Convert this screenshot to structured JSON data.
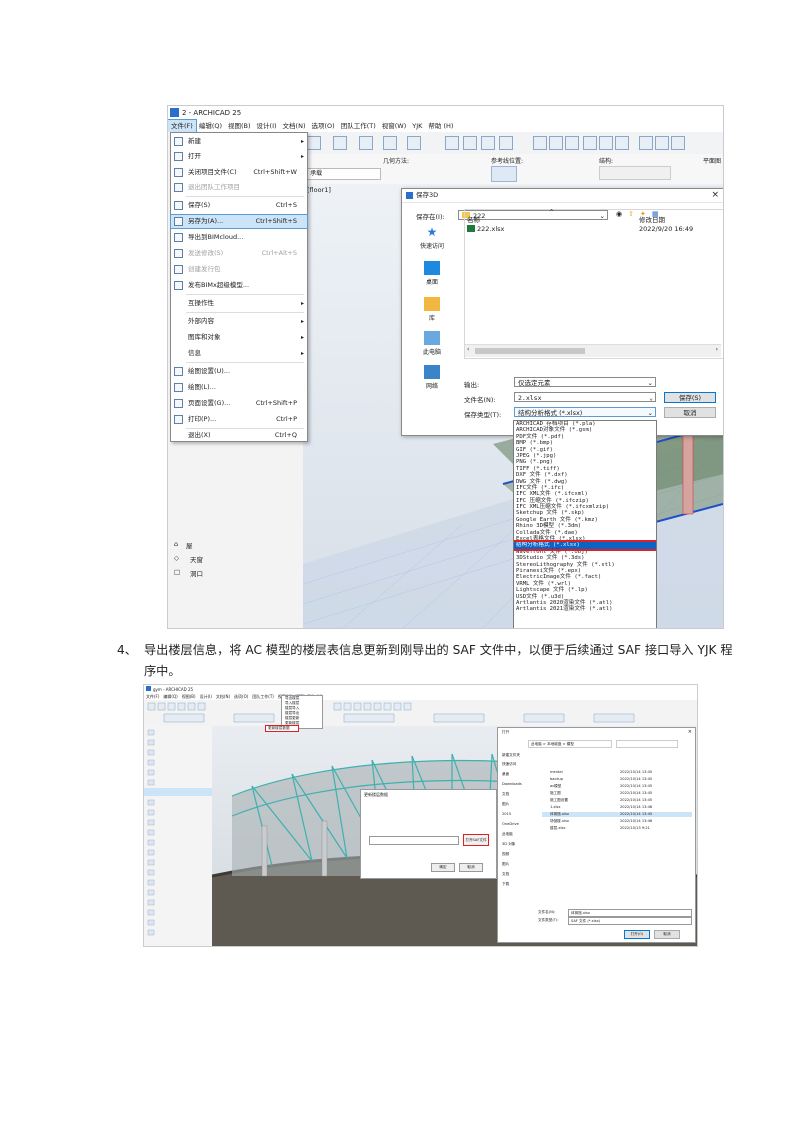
{
  "shot1": {
    "app_title": "2 - ARCHICAD 25",
    "menu": [
      "文件(F)",
      "编辑(Q)",
      "视图(B)",
      "设计(I)",
      "文档(N)",
      "选项(O)",
      "团队工作(T)",
      "视窗(W)",
      "YJK",
      "帮助 (H)"
    ],
    "infobar": {
      "geometry": "几何方法:",
      "ref_line": "参考线位置:",
      "structure": "结构:",
      "plan": "平面图"
    },
    "story_field": "- 承载",
    "floor_tab": "[floor1]",
    "file_menu": [
      {
        "label": "新建",
        "shortcut": "",
        "submenu": true,
        "state": "normal"
      },
      {
        "label": "打开",
        "shortcut": "",
        "submenu": true,
        "state": "normal"
      },
      {
        "label": "关闭项目文件(C)",
        "shortcut": "Ctrl+Shift+W",
        "submenu": false,
        "state": "normal"
      },
      {
        "label": "退出团队工作项目",
        "shortcut": "",
        "submenu": false,
        "state": "disabled"
      },
      {
        "label": "保存(S)",
        "shortcut": "Ctrl+S",
        "submenu": false,
        "state": "normal"
      },
      {
        "label": "另存为(A)...",
        "shortcut": "Ctrl+Shift+S",
        "submenu": false,
        "state": "highlight"
      },
      {
        "label": "导出到BIMcloud...",
        "shortcut": "",
        "submenu": false,
        "state": "normal"
      },
      {
        "label": "发送修改(S)",
        "shortcut": "Ctrl+Alt+S",
        "submenu": false,
        "state": "disabled"
      },
      {
        "label": "创建发行包",
        "shortcut": "",
        "submenu": false,
        "state": "disabled"
      },
      {
        "label": "发布BIMx超级模型...",
        "shortcut": "",
        "submenu": false,
        "state": "normal"
      },
      {
        "label": "互操作性",
        "shortcut": "",
        "submenu": true,
        "state": "normal"
      },
      {
        "label": "外部内容",
        "shortcut": "",
        "submenu": true,
        "state": "normal"
      },
      {
        "label": "图库和对象",
        "shortcut": "",
        "submenu": true,
        "state": "normal"
      },
      {
        "label": "信息",
        "shortcut": "",
        "submenu": true,
        "state": "normal"
      },
      {
        "label": "绘图设置(U)...",
        "shortcut": "",
        "submenu": false,
        "state": "normal"
      },
      {
        "label": "绘图(L)...",
        "shortcut": "",
        "submenu": false,
        "state": "normal"
      },
      {
        "label": "页面设置(G)...",
        "shortcut": "Ctrl+Shift+P",
        "submenu": false,
        "state": "normal"
      },
      {
        "label": "打印(P)...",
        "shortcut": "Ctrl+P",
        "submenu": false,
        "state": "normal"
      },
      {
        "label": "退出(X)",
        "shortcut": "Ctrl+Q",
        "submenu": false,
        "state": "normal"
      }
    ],
    "panel_items": [
      "屋",
      "天窗",
      "洞口"
    ],
    "save_dialog": {
      "title": "保存3D",
      "close": "×",
      "save_in_label": "保存在(I):",
      "save_in_value": "222",
      "col_name": "名称",
      "col_date": "修改日期",
      "file_name": "222.xlsx",
      "file_date": "2022/9/20 16:49",
      "nav": [
        "快速访问",
        "桌面",
        "库",
        "此电脑",
        "网络"
      ],
      "export_label": "输出:",
      "export_value": "仅选定元素",
      "filename_label": "文件名(N):",
      "filename_value": "2.xlsx",
      "filetype_label": "保存类型(T):",
      "filetype_value": "结构分析格式 (*.xlsx)",
      "save_button": "保存(S)",
      "cancel_button": "取消"
    },
    "file_types": [
      "ARCHICAD 存档项目 (*.pla)",
      "ARCHICAD对象文件 (*.gsm)",
      "PDF文件 (*.pdf)",
      "BMP (*.bmp)",
      "GIF (*.gif)",
      "JPEG (*.jpg)",
      "PNG (*.png)",
      "TIFF (*.tiff)",
      "DXF 文件 (*.dxf)",
      "DWG 文件 (*.dwg)",
      "IFC文件 (*.ifc)",
      "IFC XML文件 (*.ifcxml)",
      "IFC 压缩文件 (*.ifczip)",
      "IFC XML压缩文件 (*.ifcxmlzip)",
      "Sketchup 文件 (*.skp)",
      "Google Earth 文件 (*.kmz)",
      "Rhino 3D模型 (*.3dm)",
      "Collada文件 (*.dae)",
      "Excel表格文件 (*.xlsx)",
      "结构分析格式 (*.xlsx)",
      "Wavefront 文件 (*.obj)",
      "3DStudio 文件 (*.3ds)",
      "StereoLithography 文件 (*.stl)",
      "Piranesi文件 (*.epx)",
      "ElectricImage文件 (*.fact)",
      "VRML 文件 (*.wrl)",
      "Lightscape 文件 (*.lp)",
      "USD文件 (*.u3d)",
      "Artlantis 2020渲染文件 (*.atl)",
      "Artlantis 2021渲染文件 (*.atl)"
    ],
    "selected_type_index": 19
  },
  "caption": {
    "number": "4、",
    "text": "导出楼层信息，将 AC 模型的楼层表信息更新到刚导出的 SAF 文件中，以便于后续通过 SAF 接口导入 YJK 程序中。"
  },
  "shot2": {
    "app_title": "gym - ARCHICAD 25",
    "menu": [
      "文件(F)",
      "编辑(Q)",
      "视图(B)",
      "设计(I)",
      "文档(N)",
      "选项(O)",
      "团队工作(T)",
      "视窗(W)",
      "YJK",
      "帮助 (H)"
    ],
    "yjk_menu": [
      "导出楼层",
      "导入楼层",
      "楼层导入",
      "楼层导出",
      "楼层更新",
      "更新楼层",
      "更新楼层数据"
    ],
    "yjk_selected": "更新楼层数据",
    "small_dialog_title": "更新楼层数据",
    "open_button": "打开SAF文件",
    "ok_button": "确定",
    "cancel_button": "取消",
    "file_dialog": {
      "title": "打开",
      "path": "此电脑 > 本地磁盘 > 模型",
      "new_folder": "新建文件夹",
      "nav": [
        "快速访问",
        "桌面",
        "Downloads",
        "文档",
        "图片",
        "2015",
        "OneDrive",
        "此电脑",
        "3D 对象",
        "视频",
        "图片",
        "文档",
        "下载"
      ],
      "files": [
        {
          "name": "mental",
          "date": "2022/10/14 13:45"
        },
        {
          "name": "backup",
          "date": "2022/10/14 13:45"
        },
        {
          "name": "ac模型",
          "date": "2022/10/14 13:45"
        },
        {
          "name": "施工图",
          "date": "2022/10/14 13:45"
        },
        {
          "name": "施工图设置",
          "date": "2022/10/14 13:45"
        },
        {
          "name": "1.xlsx",
          "date": "2022/10/14 13:46"
        },
        {
          "name": "体育馆.xlsx",
          "date": "2022/10/14 13:45"
        },
        {
          "name": "场馆楼.xlsx",
          "date": "2022/10/14 13:46"
        },
        {
          "name": "楼层.xlsx",
          "date": "2022/10/13 9:21"
        }
      ],
      "filename_value": "体育馆.xlsx",
      "filetype_value": "SAF 文件 (*.xlsx)",
      "open_button": "打开(O)",
      "cancel_button": "取消"
    }
  }
}
